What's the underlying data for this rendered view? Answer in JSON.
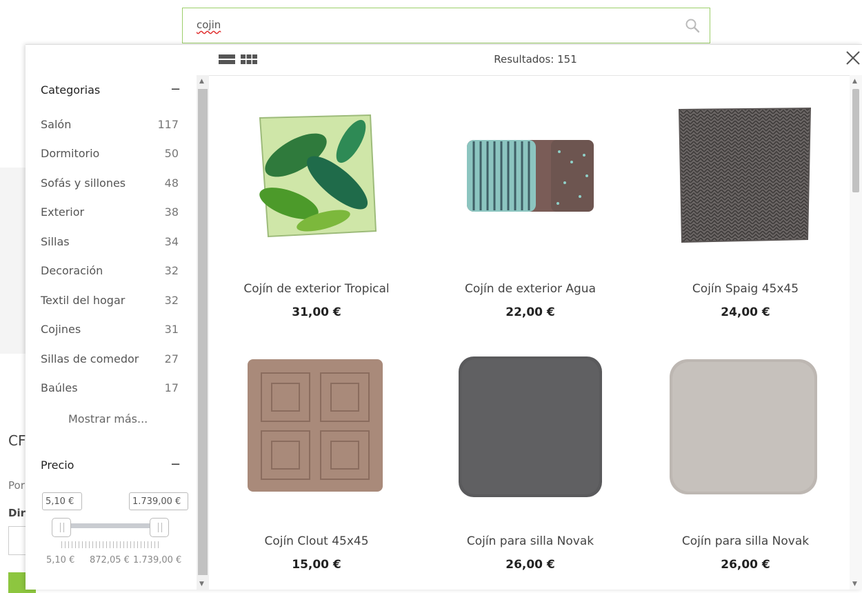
{
  "search": {
    "query": "cojin"
  },
  "background": {
    "heading": "CF",
    "line1": "Por",
    "line2": "Dir"
  },
  "toolbar": {
    "results_label": "Resultados: 151"
  },
  "sidebar": {
    "categories_title": "Categorias",
    "categories_toggle": "−",
    "categories": [
      {
        "name": "Salón",
        "count": "117"
      },
      {
        "name": "Dormitorio",
        "count": "50"
      },
      {
        "name": "Sofás y sillones",
        "count": "48"
      },
      {
        "name": "Exterior",
        "count": "38"
      },
      {
        "name": "Sillas",
        "count": "34"
      },
      {
        "name": "Decoración",
        "count": "32"
      },
      {
        "name": "Textil del hogar",
        "count": "32"
      },
      {
        "name": "Cojines",
        "count": "31"
      },
      {
        "name": "Sillas de comedor",
        "count": "27"
      },
      {
        "name": "Baúles",
        "count": "17"
      }
    ],
    "show_more": "Mostrar más...",
    "price_title": "Precio",
    "price_toggle": "−",
    "price_min": "5,10 €",
    "price_max": "1.739,00 €",
    "tick_min": "5,10 €",
    "tick_mid": "872,05 €",
    "tick_max": "1.739,00 €"
  },
  "products": [
    {
      "title": "Cojín de exterior Tropical",
      "price": "31,00 €"
    },
    {
      "title": "Cojín de exterior Agua",
      "price": "22,00 €"
    },
    {
      "title": "Cojín Spaig 45x45",
      "price": "24,00 €"
    },
    {
      "title": "Cojín Clout 45x45",
      "price": "15,00 €"
    },
    {
      "title": "Cojín para silla Novak",
      "price": "26,00 €"
    },
    {
      "title": "Cojín para silla Novak",
      "price": "26,00 €"
    }
  ]
}
